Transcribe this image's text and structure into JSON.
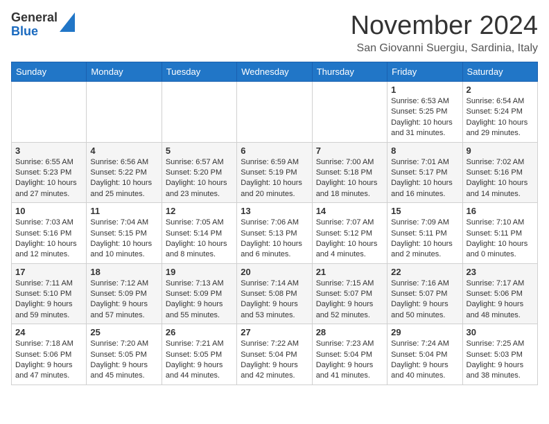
{
  "logo": {
    "general": "General",
    "blue": "Blue"
  },
  "title": "November 2024",
  "location": "San Giovanni Suergiu, Sardinia, Italy",
  "days_header": [
    "Sunday",
    "Monday",
    "Tuesday",
    "Wednesday",
    "Thursday",
    "Friday",
    "Saturday"
  ],
  "weeks": [
    [
      {
        "day": "",
        "info": ""
      },
      {
        "day": "",
        "info": ""
      },
      {
        "day": "",
        "info": ""
      },
      {
        "day": "",
        "info": ""
      },
      {
        "day": "",
        "info": ""
      },
      {
        "day": "1",
        "info": "Sunrise: 6:53 AM\nSunset: 5:25 PM\nDaylight: 10 hours and 31 minutes."
      },
      {
        "day": "2",
        "info": "Sunrise: 6:54 AM\nSunset: 5:24 PM\nDaylight: 10 hours and 29 minutes."
      }
    ],
    [
      {
        "day": "3",
        "info": "Sunrise: 6:55 AM\nSunset: 5:23 PM\nDaylight: 10 hours and 27 minutes."
      },
      {
        "day": "4",
        "info": "Sunrise: 6:56 AM\nSunset: 5:22 PM\nDaylight: 10 hours and 25 minutes."
      },
      {
        "day": "5",
        "info": "Sunrise: 6:57 AM\nSunset: 5:20 PM\nDaylight: 10 hours and 23 minutes."
      },
      {
        "day": "6",
        "info": "Sunrise: 6:59 AM\nSunset: 5:19 PM\nDaylight: 10 hours and 20 minutes."
      },
      {
        "day": "7",
        "info": "Sunrise: 7:00 AM\nSunset: 5:18 PM\nDaylight: 10 hours and 18 minutes."
      },
      {
        "day": "8",
        "info": "Sunrise: 7:01 AM\nSunset: 5:17 PM\nDaylight: 10 hours and 16 minutes."
      },
      {
        "day": "9",
        "info": "Sunrise: 7:02 AM\nSunset: 5:16 PM\nDaylight: 10 hours and 14 minutes."
      }
    ],
    [
      {
        "day": "10",
        "info": "Sunrise: 7:03 AM\nSunset: 5:16 PM\nDaylight: 10 hours and 12 minutes."
      },
      {
        "day": "11",
        "info": "Sunrise: 7:04 AM\nSunset: 5:15 PM\nDaylight: 10 hours and 10 minutes."
      },
      {
        "day": "12",
        "info": "Sunrise: 7:05 AM\nSunset: 5:14 PM\nDaylight: 10 hours and 8 minutes."
      },
      {
        "day": "13",
        "info": "Sunrise: 7:06 AM\nSunset: 5:13 PM\nDaylight: 10 hours and 6 minutes."
      },
      {
        "day": "14",
        "info": "Sunrise: 7:07 AM\nSunset: 5:12 PM\nDaylight: 10 hours and 4 minutes."
      },
      {
        "day": "15",
        "info": "Sunrise: 7:09 AM\nSunset: 5:11 PM\nDaylight: 10 hours and 2 minutes."
      },
      {
        "day": "16",
        "info": "Sunrise: 7:10 AM\nSunset: 5:11 PM\nDaylight: 10 hours and 0 minutes."
      }
    ],
    [
      {
        "day": "17",
        "info": "Sunrise: 7:11 AM\nSunset: 5:10 PM\nDaylight: 9 hours and 59 minutes."
      },
      {
        "day": "18",
        "info": "Sunrise: 7:12 AM\nSunset: 5:09 PM\nDaylight: 9 hours and 57 minutes."
      },
      {
        "day": "19",
        "info": "Sunrise: 7:13 AM\nSunset: 5:09 PM\nDaylight: 9 hours and 55 minutes."
      },
      {
        "day": "20",
        "info": "Sunrise: 7:14 AM\nSunset: 5:08 PM\nDaylight: 9 hours and 53 minutes."
      },
      {
        "day": "21",
        "info": "Sunrise: 7:15 AM\nSunset: 5:07 PM\nDaylight: 9 hours and 52 minutes."
      },
      {
        "day": "22",
        "info": "Sunrise: 7:16 AM\nSunset: 5:07 PM\nDaylight: 9 hours and 50 minutes."
      },
      {
        "day": "23",
        "info": "Sunrise: 7:17 AM\nSunset: 5:06 PM\nDaylight: 9 hours and 48 minutes."
      }
    ],
    [
      {
        "day": "24",
        "info": "Sunrise: 7:18 AM\nSunset: 5:06 PM\nDaylight: 9 hours and 47 minutes."
      },
      {
        "day": "25",
        "info": "Sunrise: 7:20 AM\nSunset: 5:05 PM\nDaylight: 9 hours and 45 minutes."
      },
      {
        "day": "26",
        "info": "Sunrise: 7:21 AM\nSunset: 5:05 PM\nDaylight: 9 hours and 44 minutes."
      },
      {
        "day": "27",
        "info": "Sunrise: 7:22 AM\nSunset: 5:04 PM\nDaylight: 9 hours and 42 minutes."
      },
      {
        "day": "28",
        "info": "Sunrise: 7:23 AM\nSunset: 5:04 PM\nDaylight: 9 hours and 41 minutes."
      },
      {
        "day": "29",
        "info": "Sunrise: 7:24 AM\nSunset: 5:04 PM\nDaylight: 9 hours and 40 minutes."
      },
      {
        "day": "30",
        "info": "Sunrise: 7:25 AM\nSunset: 5:03 PM\nDaylight: 9 hours and 38 minutes."
      }
    ]
  ]
}
